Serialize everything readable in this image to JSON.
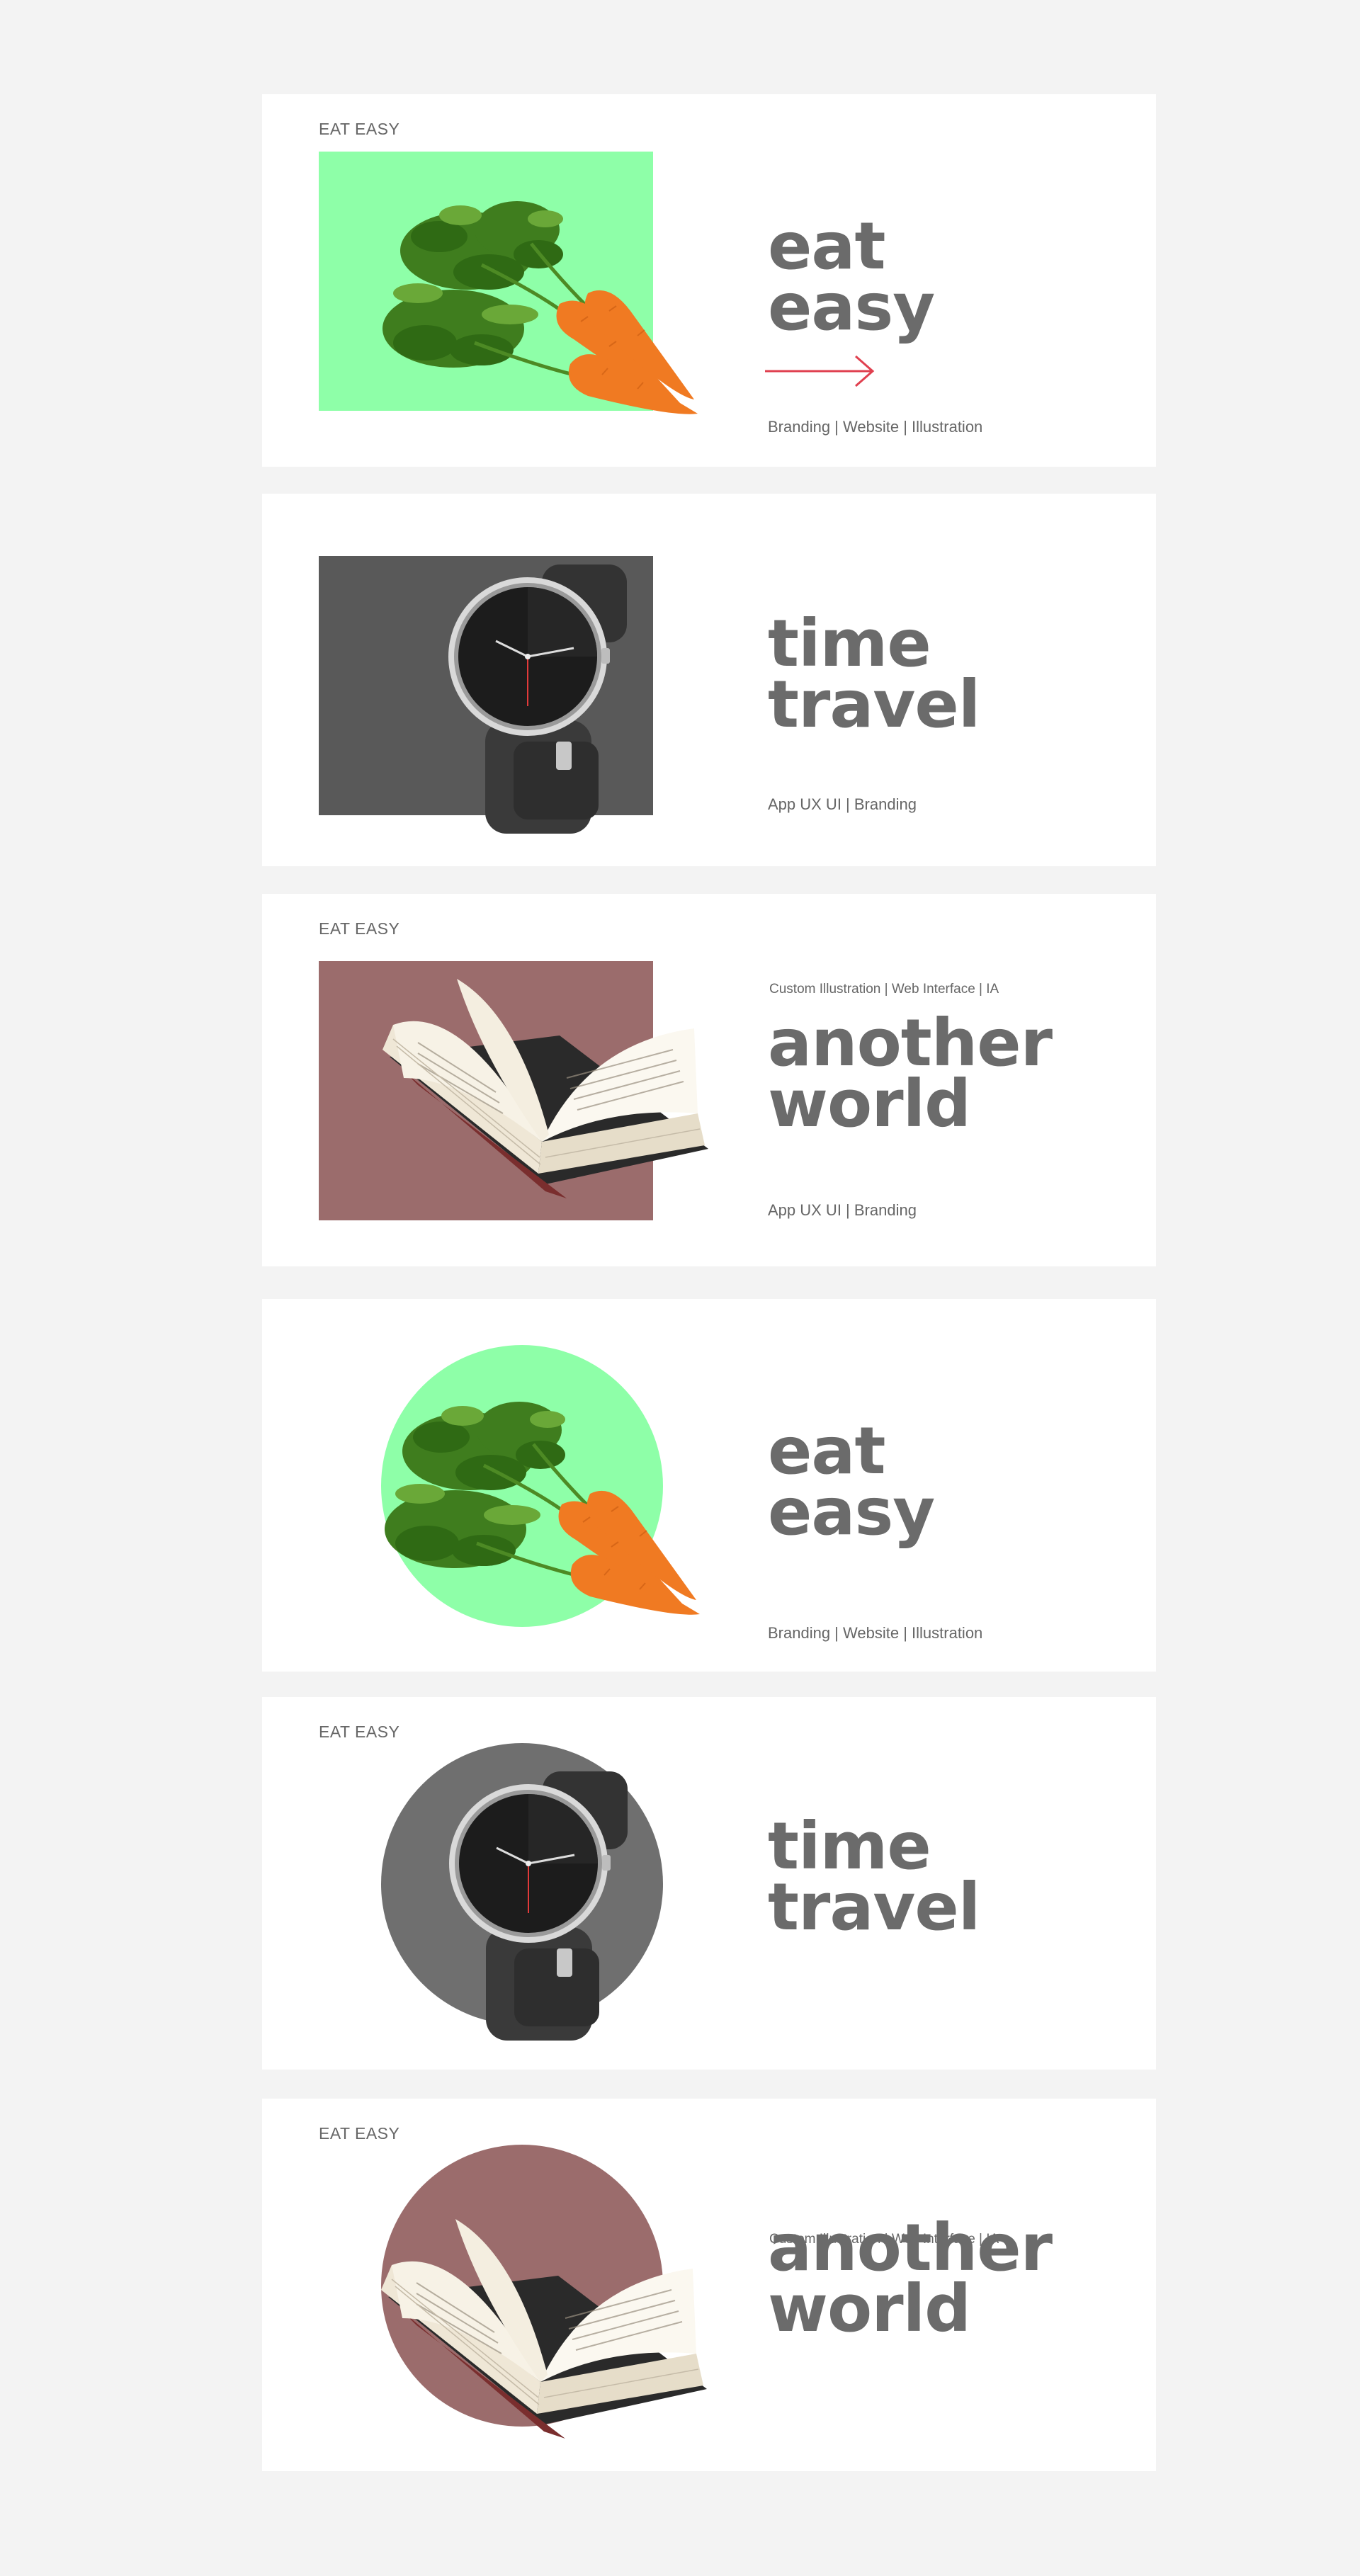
{
  "colors": {
    "page_bg": "#f3f3f3",
    "card_bg": "#ffffff",
    "title_text": "#6b6b6b",
    "green": "#8effa8",
    "grey": "#595959",
    "mauve": "#9b6c6c",
    "accent_arrow": "#e0404f"
  },
  "cards": [
    {
      "tag": "EAT EASY",
      "title_line1": "eat",
      "title_line2": "easy",
      "pretitle": "",
      "subtitle": "Branding | Website | Illustration",
      "media": "carrots-illustration",
      "shape": "rectangle",
      "has_arrow": true
    },
    {
      "tag": "",
      "title_line1": "time",
      "title_line2": "travel",
      "pretitle": "",
      "subtitle": "App UX UI | Branding",
      "media": "watch-illustration",
      "shape": "rectangle",
      "has_arrow": false
    },
    {
      "tag": "EAT EASY",
      "title_line1": "another",
      "title_line2": "world",
      "pretitle": "Custom Illustration | Web Interface | IA",
      "subtitle": "App UX UI | Branding",
      "media": "open-book-illustration",
      "shape": "rectangle",
      "has_arrow": false
    },
    {
      "tag": "",
      "title_line1": "eat",
      "title_line2": "easy",
      "pretitle": "",
      "subtitle": "Branding | Website | Illustration",
      "media": "carrots-illustration",
      "shape": "circle",
      "has_arrow": false
    },
    {
      "tag": "EAT EASY",
      "title_line1": "time",
      "title_line2": "travel",
      "pretitle": "",
      "subtitle": "",
      "media": "watch-illustration",
      "shape": "circle",
      "has_arrow": false
    },
    {
      "tag": "EAT EASY",
      "title_line1": "another",
      "title_line2": "world",
      "pretitle": "Custom Illustration | Web Interface | IA",
      "subtitle": "",
      "media": "open-book-illustration",
      "shape": "circle",
      "has_arrow": false
    }
  ]
}
